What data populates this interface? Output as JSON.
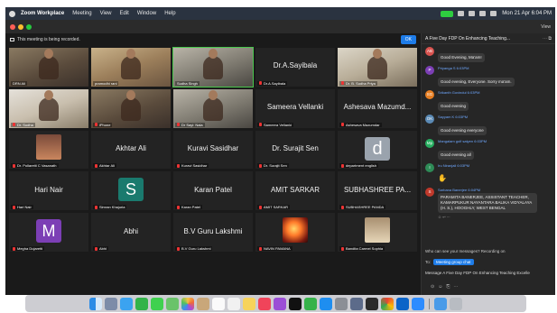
{
  "menubar": {
    "app_name": "Zoom Workplace",
    "items": [
      "Meeting",
      "View",
      "Edit",
      "Window",
      "Help"
    ],
    "clock": "Mon 21 Apr 6:04 PM"
  },
  "window": {
    "view_label": "View",
    "recording_notice": "This meeting is being recorded.",
    "ok_label": "OK"
  },
  "tiles": [
    {
      "label": "DRN Ali",
      "big": ""
    },
    {
      "label": "pramodhi rani",
      "big": ""
    },
    {
      "label": "Sudha Singh",
      "big": ""
    },
    {
      "label": "Dr.A.Sayibala",
      "big": "Dr.A.Sayibala"
    },
    {
      "label": "Dr. B. Sudha Priya",
      "big": ""
    },
    {
      "label": "Dr. Sudha",
      "big": ""
    },
    {
      "label": "iPhone",
      "big": ""
    },
    {
      "label": "Dr Sayi: Nala",
      "big": ""
    },
    {
      "label": "Sameera Vellanki",
      "big": "Sameera Vellanki"
    },
    {
      "label": "Ashesava Mazumdar",
      "big": "Ashesava Mazumd..."
    },
    {
      "label": "Dr. Pollaretti C Vasanath",
      "big": ""
    },
    {
      "label": "Akhtar Ali",
      "big": "Akhtar Ali"
    },
    {
      "label": "Kuravi Sasidhar",
      "big": "Kuravi Sasidhar"
    },
    {
      "label": "Dr. Surajit Sen",
      "big": "Dr. Surajit Sen"
    },
    {
      "label": "department english",
      "big": ""
    },
    {
      "label": "Hari Nair",
      "big": "Hari Nair"
    },
    {
      "label": "Simran Khajuria",
      "big": ""
    },
    {
      "label": "Karan Patel",
      "big": "Karan Patel"
    },
    {
      "label": "AMIT SARKAR",
      "big": "AMIT SARKAR"
    },
    {
      "label": "SUBHASHREE PANDA",
      "big": "SUBHASHREE PA..."
    },
    {
      "label": "Megha Dujaretti",
      "big": ""
    },
    {
      "label": "Abhi",
      "big": "Abhi"
    },
    {
      "label": "B.V Guru Lakshmi",
      "big": "B.V Guru Lakshmi"
    },
    {
      "label": "NAVIN PAMANA",
      "big": ""
    },
    {
      "label": "Bandita Carmel Sophia",
      "big": ""
    }
  ],
  "avatars": {
    "s": "S",
    "m": "M",
    "d": "d"
  },
  "chat": {
    "title": "A Five Day FDP On Enhancing Teaching...",
    "messages": [
      {
        "initials": "AB",
        "color": "#d9534f",
        "meta": "",
        "text": "Good Evening, Ma'am!"
      },
      {
        "initials": "P",
        "color": "#7c3fb5",
        "meta": "Priyanga S  6:03PM",
        "text": "Good evening, Everyone. Sorry ma'am."
      },
      {
        "initials": "SG",
        "color": "#e67e22",
        "meta": "Srikanth Govindul  6:03PM",
        "text": "Good evening"
      },
      {
        "initials": "OK",
        "color": "#5b8ab5",
        "meta": "Sayyam K  6:03PM",
        "text": "Good evening everyone"
      },
      {
        "initials": "Mp",
        "color": "#27ae60",
        "meta": "Mangalam golf  satyen  6:03PM",
        "text": "Good evening all"
      },
      {
        "initials": "I",
        "color": "#2e8b57",
        "meta": "Iru Niranjali  6:03PM",
        "text": "✋"
      },
      {
        "initials": "S",
        "color": "#c0392b",
        "meta": "Sarbana Banerjee  6:04PM",
        "text": "PARAMITA BANERJEE, ASSISTANT TEACHER, KAMARPUKUR NAYANTARA BALIKA VIDYALAYA (H. S.), HOOGHLY, WEST BENGAL"
      }
    ],
    "who_can_see": "Who can see your messages? Recording on",
    "to_label": "To:",
    "to_target": "Meeting group chat",
    "compose_value": "Message A Five Day FDP On Enhancing Teaching Excelle"
  }
}
